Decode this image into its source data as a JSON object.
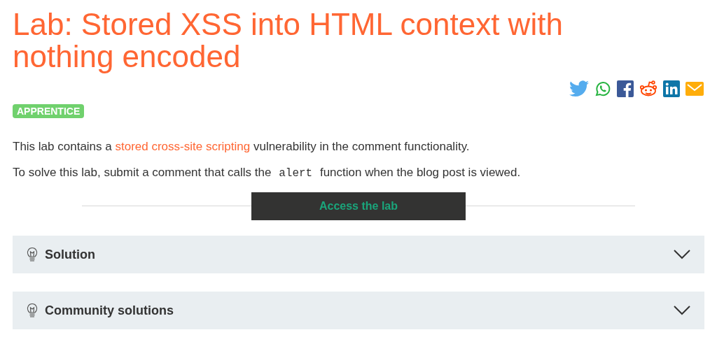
{
  "title": "Lab: Stored XSS into HTML context with nothing encoded",
  "level_badge": "APPRENTICE",
  "description": {
    "before": "This lab contains a ",
    "link": "stored cross-site scripting",
    "after": " vulnerability in the comment functionality."
  },
  "task": {
    "before": "To solve this lab, submit a comment that calls the ",
    "code": "alert",
    "after": " function when the blog post is viewed."
  },
  "access_button": "Access the lab",
  "sections": [
    {
      "label": "Solution",
      "expanded": false
    },
    {
      "label": "Community solutions",
      "expanded": false
    }
  ]
}
